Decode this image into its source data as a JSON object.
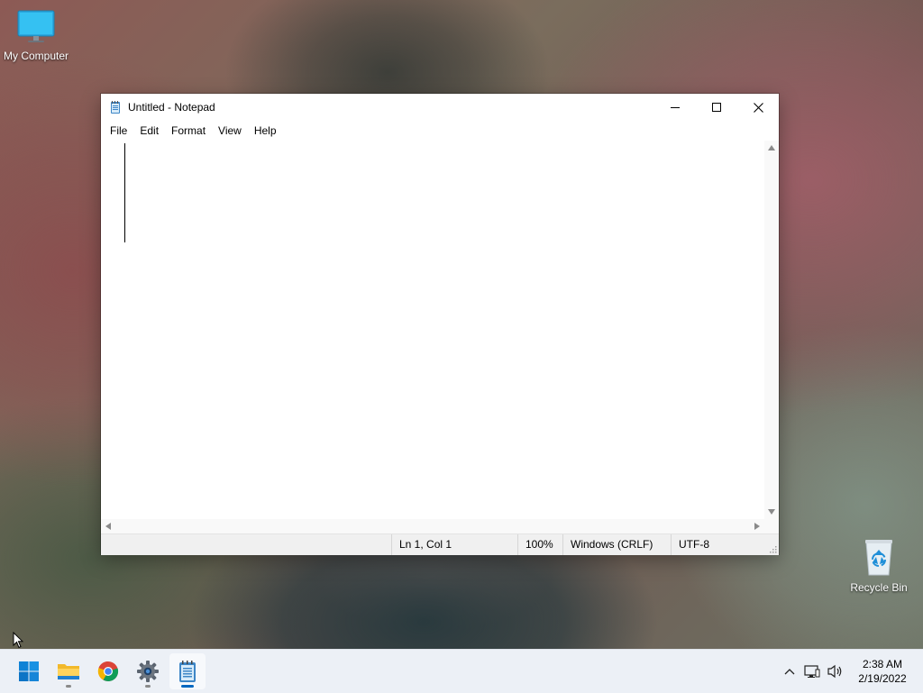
{
  "desktop": {
    "icons": [
      {
        "label": "My Computer",
        "icon": "monitor-icon"
      },
      {
        "label": "Recycle Bin",
        "icon": "recycle-bin-icon"
      }
    ]
  },
  "window": {
    "title": "Untitled - Notepad",
    "app_icon": "notepad-icon",
    "controls": [
      "minimize-icon",
      "maximize-icon",
      "close-icon"
    ],
    "menu": [
      "File",
      "Edit",
      "Format",
      "View",
      "Help"
    ],
    "editor_text": "",
    "status": {
      "position": "Ln 1, Col 1",
      "zoom": "100%",
      "line_ending": "Windows (CRLF)",
      "encoding": "UTF-8"
    }
  },
  "taskbar": {
    "apps": [
      {
        "name": "Start",
        "icon": "windows-start-icon"
      },
      {
        "name": "File Explorer",
        "icon": "folder-icon",
        "running": true
      },
      {
        "name": "Google Chrome",
        "icon": "chrome-icon",
        "running": false
      },
      {
        "name": "Settings",
        "icon": "gear-icon",
        "running": true
      },
      {
        "name": "Notepad",
        "icon": "notepad-icon",
        "running": true,
        "active": true
      }
    ],
    "tray": {
      "icons": [
        "chevron-up-icon",
        "network-icon",
        "volume-icon"
      ],
      "time": "2:38 AM",
      "date": "2/19/2022"
    }
  },
  "colors": {
    "accent": "#0067c0",
    "taskbar": "#ecf0f6",
    "statusbar": "#f0f0f0"
  }
}
